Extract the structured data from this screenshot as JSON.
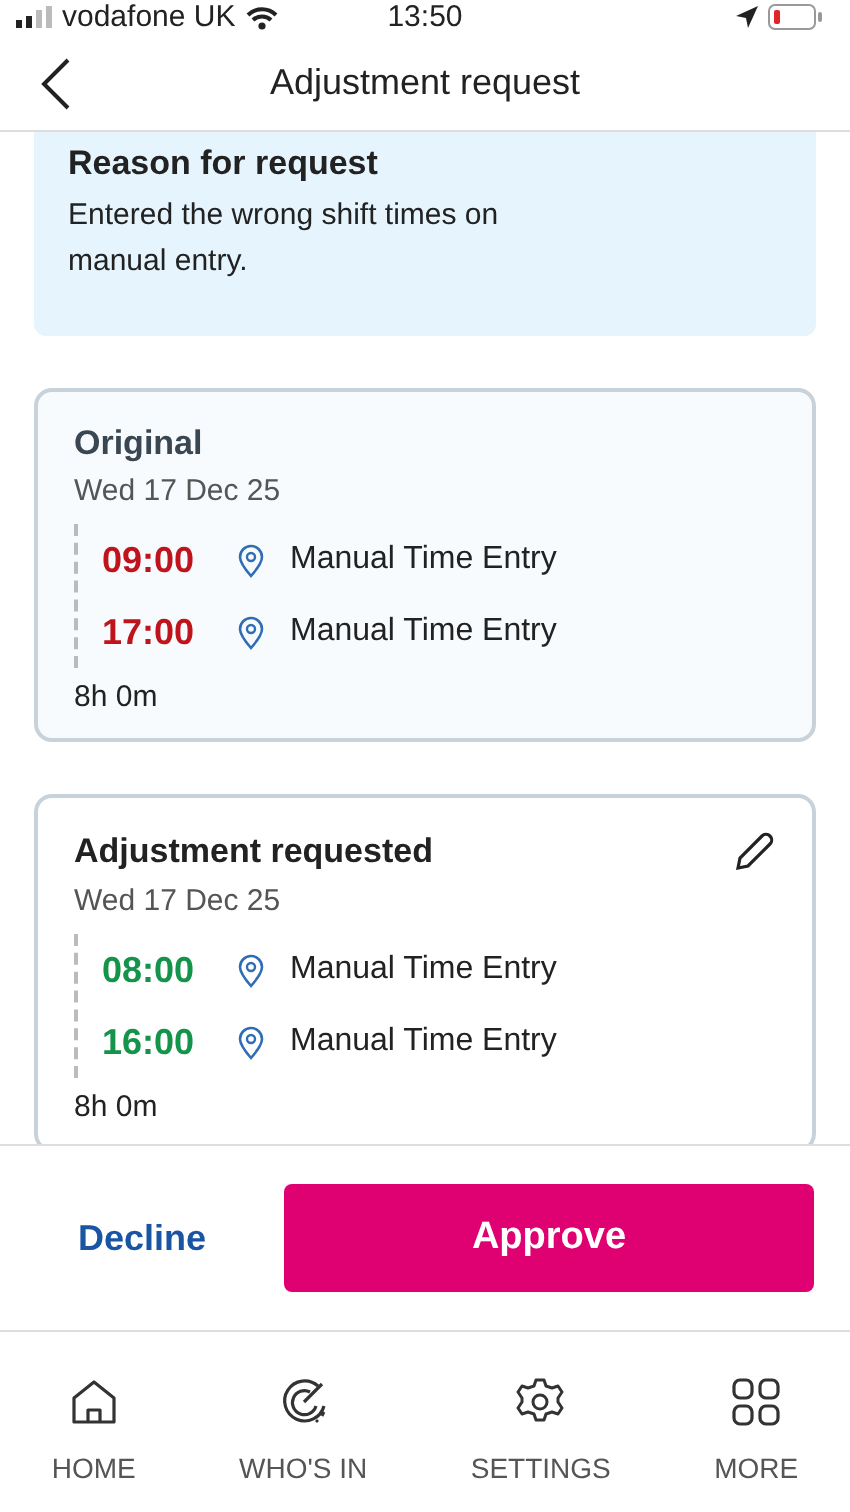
{
  "status_bar": {
    "carrier": "vodafone UK",
    "time": "13:50"
  },
  "header": {
    "title": "Adjustment request"
  },
  "reason": {
    "title": "Reason for request",
    "text": "Entered the wrong shift times on manual entry."
  },
  "cards": [
    {
      "kind": "original",
      "title": "Original",
      "editable": false,
      "date": "Wed 17 Dec 25",
      "entries": [
        {
          "time": "09:00",
          "source": "Manual Time Entry"
        },
        {
          "time": "17:00",
          "source": "Manual Time Entry"
        }
      ],
      "duration": "8h 0m"
    },
    {
      "kind": "requested",
      "title": "Adjustment requested",
      "editable": true,
      "date": "Wed 17 Dec 25",
      "entries": [
        {
          "time": "08:00",
          "source": "Manual Time Entry"
        },
        {
          "time": "16:00",
          "source": "Manual Time Entry"
        }
      ],
      "duration": "8h 0m"
    }
  ],
  "actions": {
    "decline": "Decline",
    "approve": "Approve"
  },
  "tab_bar": [
    {
      "kind": "home",
      "label": "HOME"
    },
    {
      "kind": "whos_in",
      "label": "WHO'S IN"
    },
    {
      "kind": "settings",
      "label": "SETTINGS"
    },
    {
      "kind": "more",
      "label": "MORE"
    }
  ]
}
